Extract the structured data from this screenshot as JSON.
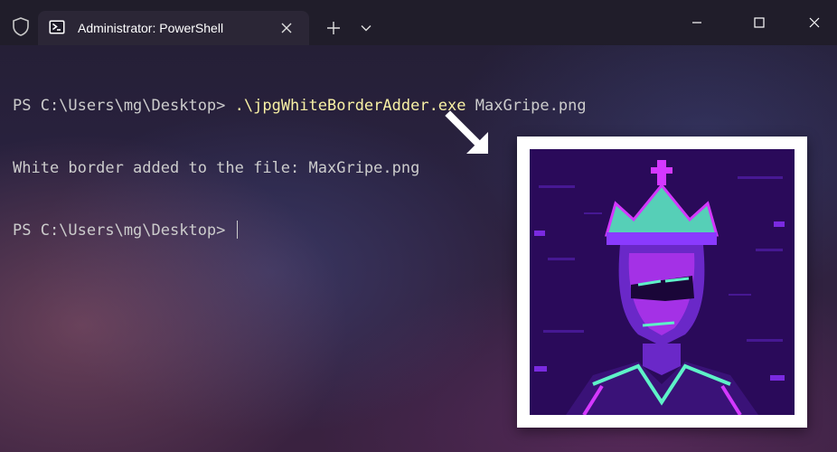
{
  "window": {
    "tab_title": "Administrator: PowerShell"
  },
  "terminal": {
    "line1_prompt": "PS C:\\Users\\mg\\Desktop> ",
    "line1_command": ".\\jpgWhiteBorderAdder.exe",
    "line1_args": " MaxGripe.png",
    "line2_output": "White border added to the file: MaxGripe.png",
    "line3_prompt": "PS C:\\Users\\mg\\Desktop> "
  },
  "colors": {
    "command_yellow": "#f9f1a5",
    "text": "#cccccc",
    "titlebar": "#201d2a",
    "tab": "#2b2636",
    "image_purple": "#2a0a5a",
    "image_cyan": "#5ef2c8",
    "image_magenta": "#d438ff"
  },
  "icons": {
    "shield": "shield-icon",
    "powershell": "powershell-icon",
    "close_tab": "close-icon",
    "new_tab": "plus-icon",
    "dropdown": "chevron-down-icon",
    "minimize": "minimize-icon",
    "maximize": "maximize-icon",
    "close_window": "close-icon",
    "pointer": "arrow-down-right-icon"
  }
}
